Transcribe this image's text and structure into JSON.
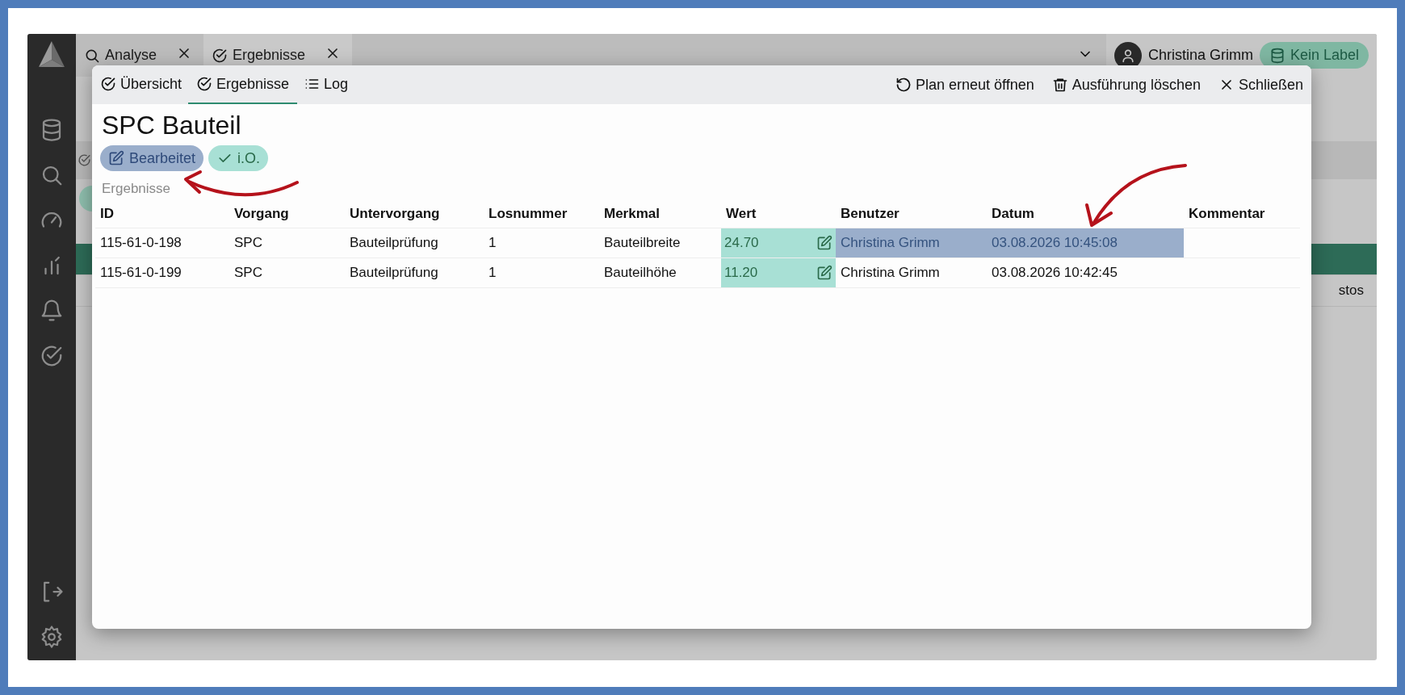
{
  "top_tabs": [
    {
      "label": "Analyse",
      "selected": false
    },
    {
      "label": "Ergebnisse",
      "selected": true
    }
  ],
  "user": {
    "name": "Christina Grimm"
  },
  "label_chip": {
    "label": "Kein Label"
  },
  "background": {
    "rows": [
      {
        "selected": true
      },
      {
        "selected": false,
        "last_cell": "stos"
      }
    ]
  },
  "dialog": {
    "tabs": [
      {
        "label": "Übersicht",
        "selected": false
      },
      {
        "label": "Ergebnisse",
        "selected": true
      },
      {
        "label": "Log",
        "selected": false
      }
    ],
    "actions": [
      {
        "label": "Plan erneut öffnen"
      },
      {
        "label": "Ausführung löschen"
      },
      {
        "label": "Schließen"
      }
    ],
    "title": "SPC Bauteil",
    "badges": [
      {
        "label": "Bearbeitet",
        "kind": "edited"
      },
      {
        "label": "i.O.",
        "kind": "ok"
      }
    ],
    "section_label": "Ergebnisse",
    "table": {
      "columns": [
        "ID",
        "Vorgang",
        "Untervorgang",
        "Losnummer",
        "Merkmal",
        "Wert",
        "Benutzer",
        "Datum",
        "Kommentar"
      ],
      "rows": [
        {
          "selected": true,
          "cells": [
            "115-61-0-198",
            "SPC",
            "Bauteilprüfung",
            "1",
            "Bauteilbreite",
            "24.70",
            "Christina Grimm",
            "03.08.2026 10:45:08"
          ]
        },
        {
          "selected": false,
          "cells": [
            "115-61-0-199",
            "SPC",
            "Bauteilprüfung",
            "1",
            "Bauteilhöhe",
            "11.20",
            "Christina Grimm",
            "03.08.2026 10:42:45"
          ]
        }
      ]
    }
  }
}
